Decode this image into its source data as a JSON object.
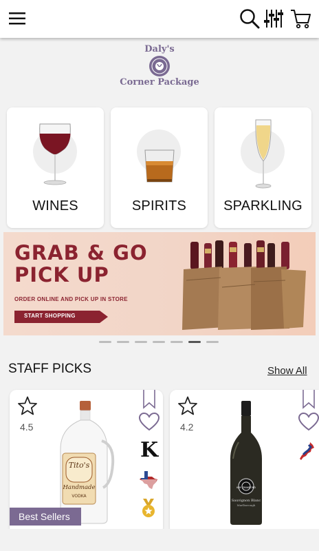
{
  "header": {
    "menu_icon": "hamburger-icon",
    "search_icon": "search-icon",
    "filter_icon": "filter-sliders-icon",
    "cart_icon": "cart-icon"
  },
  "logo": {
    "line1": "Daly's",
    "line2": "Corner Package",
    "seal_text": "FINE SPIRITS WINE BEER"
  },
  "categories": [
    {
      "label": "WINES",
      "icon": "wine-glass-icon"
    },
    {
      "label": "SPIRITS",
      "icon": "whiskey-glass-icon"
    },
    {
      "label": "SPARKLING",
      "icon": "champagne-flute-icon"
    }
  ],
  "banner": {
    "headline_1": "GRAB & GO",
    "headline_2": "PICK UP",
    "subtitle": "ORDER ONLINE AND PICK UP IN STORE",
    "button": "START SHOPPING",
    "accent": "#8b2330"
  },
  "carousel": {
    "count": 7,
    "active_index": 5
  },
  "staff_picks": {
    "title": "STAFF PICKS",
    "show_all": "Show All",
    "products": [
      {
        "rating": "4.5",
        "badge": "Best Sellers",
        "kosher": "K",
        "bottle_label_1": "Tito's",
        "bottle_label_2": "Handmade",
        "bottle_label_3": "VODKA"
      },
      {
        "rating": "4.2",
        "bottle_label_1": "KIM CRAWFORD",
        "bottle_label_2": "Sauvignon Blanc",
        "bottle_label_3": "Marlborough"
      }
    ]
  },
  "colors": {
    "brand": "#7b6a92",
    "heart": "#7b6a92"
  }
}
